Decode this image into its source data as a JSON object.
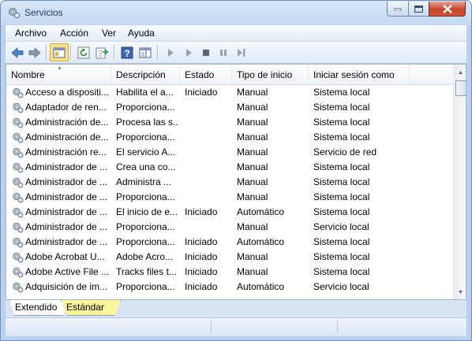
{
  "window": {
    "title": "Servicios"
  },
  "menu": [
    "Archivo",
    "Acción",
    "Ver",
    "Ayuda"
  ],
  "toolbar": {
    "icons": [
      "back-arrow-icon",
      "forward-arrow-icon",
      "console-tree-icon",
      "refresh-icon",
      "export-icon",
      "help-icon",
      "properties-pane-icon",
      "start-icon",
      "start-alt-icon",
      "stop-icon",
      "pause-icon",
      "restart-icon"
    ]
  },
  "columns": {
    "name": "Nombre",
    "description": "Descripción",
    "state": "Estado",
    "startup": "Tipo de inicio",
    "login": "Iniciar sesión como"
  },
  "rows": [
    {
      "name": "Acceso a dispositi...",
      "description": "Habilita el a...",
      "state": "Iniciado",
      "startup": "Manual",
      "login": "Sistema local"
    },
    {
      "name": "Adaptador de ren...",
      "description": "Proporciona...",
      "state": "",
      "startup": "Manual",
      "login": "Sistema local"
    },
    {
      "name": "Administración de...",
      "description": "Procesa las s...",
      "state": "",
      "startup": "Manual",
      "login": "Sistema local"
    },
    {
      "name": "Administración de...",
      "description": "Proporciona...",
      "state": "",
      "startup": "Manual",
      "login": "Sistema local"
    },
    {
      "name": "Administración re...",
      "description": "El servicio A...",
      "state": "",
      "startup": "Manual",
      "login": "Servicio de red"
    },
    {
      "name": "Administrador de ...",
      "description": "Crea una co...",
      "state": "",
      "startup": "Manual",
      "login": "Sistema local"
    },
    {
      "name": "Administrador de ...",
      "description": "Administra ...",
      "state": "",
      "startup": "Manual",
      "login": "Sistema local"
    },
    {
      "name": "Administrador de ...",
      "description": "Proporciona...",
      "state": "",
      "startup": "Manual",
      "login": "Sistema local"
    },
    {
      "name": "Administrador de ...",
      "description": "El inicio de e...",
      "state": "Iniciado",
      "startup": "Automático",
      "login": "Sistema local"
    },
    {
      "name": "Administrador de ...",
      "description": "Proporciona...",
      "state": "",
      "startup": "Manual",
      "login": "Servicio local"
    },
    {
      "name": "Administrador de ...",
      "description": "Proporciona...",
      "state": "Iniciado",
      "startup": "Automático",
      "login": "Sistema local"
    },
    {
      "name": "Adobe Acrobat U...",
      "description": "Adobe Acro...",
      "state": "Iniciado",
      "startup": "Manual",
      "login": "Sistema local"
    },
    {
      "name": "Adobe Active File ...",
      "description": "Tracks files t...",
      "state": "Iniciado",
      "startup": "Manual",
      "login": "Sistema local"
    },
    {
      "name": "Adquisición de im...",
      "description": "Proporciona...",
      "state": "Iniciado",
      "startup": "Automático",
      "login": "Servicio local"
    }
  ],
  "tabs": {
    "extended": "Extendido",
    "standard": "Estándar"
  },
  "colors": {
    "selected_tab": "#fbf59a",
    "toolbar_active": "#fbe28a"
  }
}
